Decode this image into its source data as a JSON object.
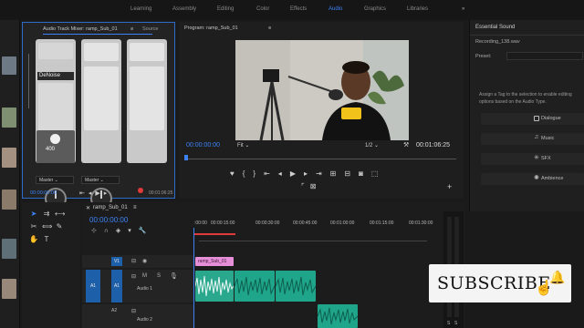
{
  "workspace_tabs": [
    {
      "label": "Learning",
      "active": false
    },
    {
      "label": "Assembly",
      "active": false
    },
    {
      "label": "Editing",
      "active": false
    },
    {
      "label": "Color",
      "active": false
    },
    {
      "label": "Effects",
      "active": false
    },
    {
      "label": "Audio",
      "active": true
    },
    {
      "label": "Graphics",
      "active": false
    },
    {
      "label": "Libraries",
      "active": false
    }
  ],
  "mixer": {
    "tab_label": "Audio Track Mixer: ramp_Sub_01",
    "source_tab": "Source",
    "effect_slot": "DeNoise",
    "gain_value": "400",
    "channels": [
      "Master",
      "Master"
    ],
    "timecode": "00:00:00:00",
    "end_timecode": "00:01:06:25"
  },
  "program": {
    "tab_label": "Program: ramp_Sub_01",
    "timecode": "00:00:00:00",
    "fit_label": "Fit",
    "resolution": "1/2",
    "duration": "00:01:06:25"
  },
  "essential_sound": {
    "title": "Essential Sound",
    "file": "Recording_138.wav",
    "preset_label": "Preset:",
    "hint": "Assign a Tag to the selection to enable editing options based on the Audio Type.",
    "buttons": [
      "Dialogue",
      "Music",
      "SFX",
      "Ambience"
    ]
  },
  "timeline": {
    "tab_label": "ramp_Sub_01",
    "timecode": "00:00:00:00",
    "ruler": [
      ":00:00",
      "00:00:15:00",
      "00:00:30:00",
      "00:00:45:00",
      "00:01:00:00",
      "00:01:15:00",
      "00:01:30:00"
    ],
    "tracks": [
      {
        "target": "V1",
        "name": "V1"
      },
      {
        "target": "A1",
        "name": "A1",
        "label": "Audio 1"
      },
      {
        "target": "A2",
        "name": "A2",
        "label": "Audio 2"
      }
    ],
    "video_clip": "ramp_Sub_01"
  },
  "meter_scale": [
    "S",
    "S"
  ],
  "subscribe": {
    "label": "SUBSCRIBE"
  },
  "colors": {
    "accent": "#3c82f6",
    "video_clip": "#e68fd8",
    "audio_clip": "#1fa58a",
    "record": "#e03a3a"
  }
}
